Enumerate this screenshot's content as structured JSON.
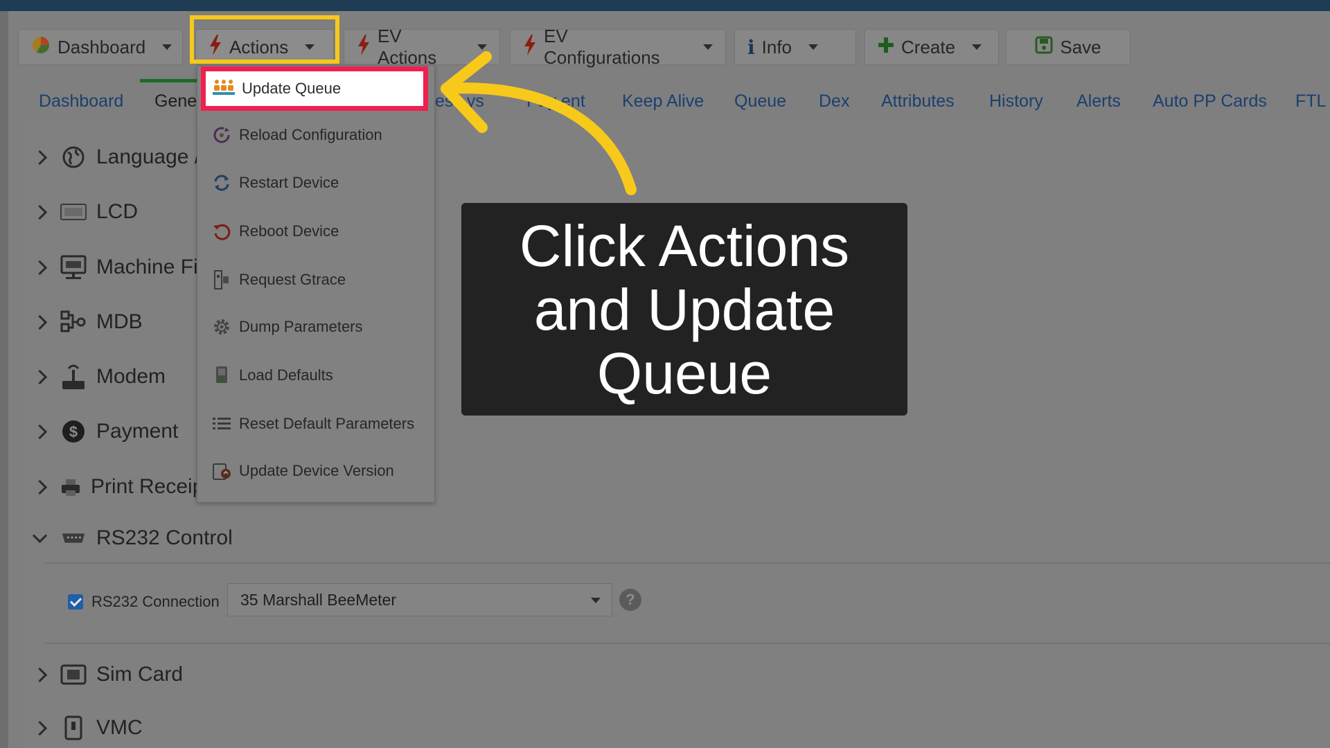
{
  "toolbar": {
    "dashboard": "Dashboard",
    "actions": "Actions",
    "ev_actions": "EV Actions",
    "ev_configurations": "EV Configurations",
    "info": "Info",
    "create": "Create",
    "save": "Save"
  },
  "tabs": [
    "Dashboard",
    "Gene",
    "",
    "Keep Alive",
    "Queue",
    "Dex",
    "Attributes",
    "History",
    "Alerts",
    "Auto PP Cards",
    "FTL"
  ],
  "tabs_partial_behind_menu": [
    "esc   ys",
    "Pay   ent"
  ],
  "tree": [
    {
      "label": "Language /",
      "icon": "globe-icon"
    },
    {
      "label": "LCD",
      "icon": "lcd-icon"
    },
    {
      "label": "Machine Fi",
      "icon": "ftp-icon"
    },
    {
      "label": "MDB",
      "icon": "mdb-icon"
    },
    {
      "label": "Modem",
      "icon": "modem-icon"
    },
    {
      "label": "Payment",
      "icon": "dollar-icon"
    },
    {
      "label": "Print Receip",
      "icon": "printer-icon"
    },
    {
      "label": "RS232 Control",
      "icon": "serial-port-icon",
      "expanded": true
    },
    {
      "label": "Sim Card",
      "icon": "sim-card-icon"
    },
    {
      "label": "VMC",
      "icon": "vmc-icon"
    }
  ],
  "rs232": {
    "checkbox_label": "RS232 Connection",
    "checked": true,
    "selected": "35 Marshall BeeMeter"
  },
  "actions_menu": [
    {
      "label": "Update Queue",
      "icon": "queue-icon",
      "highlighted": true
    },
    {
      "label": "Reload Configuration",
      "icon": "reload-icon"
    },
    {
      "label": "Restart Device",
      "icon": "restart-icon"
    },
    {
      "label": "Reboot Device",
      "icon": "reboot-icon"
    },
    {
      "label": "Request Gtrace",
      "icon": "gtrace-icon"
    },
    {
      "label": "Dump Parameters",
      "icon": "gear-icon"
    },
    {
      "label": "Load Defaults",
      "icon": "load-defaults-icon"
    },
    {
      "label": "Reset Default Parameters",
      "icon": "list-icon"
    },
    {
      "label": "Update Device Version",
      "icon": "update-version-icon"
    }
  ],
  "callout": {
    "line1": "Click Actions",
    "line2": "and Update",
    "line3": "Queue"
  },
  "colors": {
    "highlight_yellow": "#f7c91b",
    "highlight_red": "#ef1f4f",
    "callout_bg": "#222222",
    "tab_link": "#1b3f6e"
  }
}
